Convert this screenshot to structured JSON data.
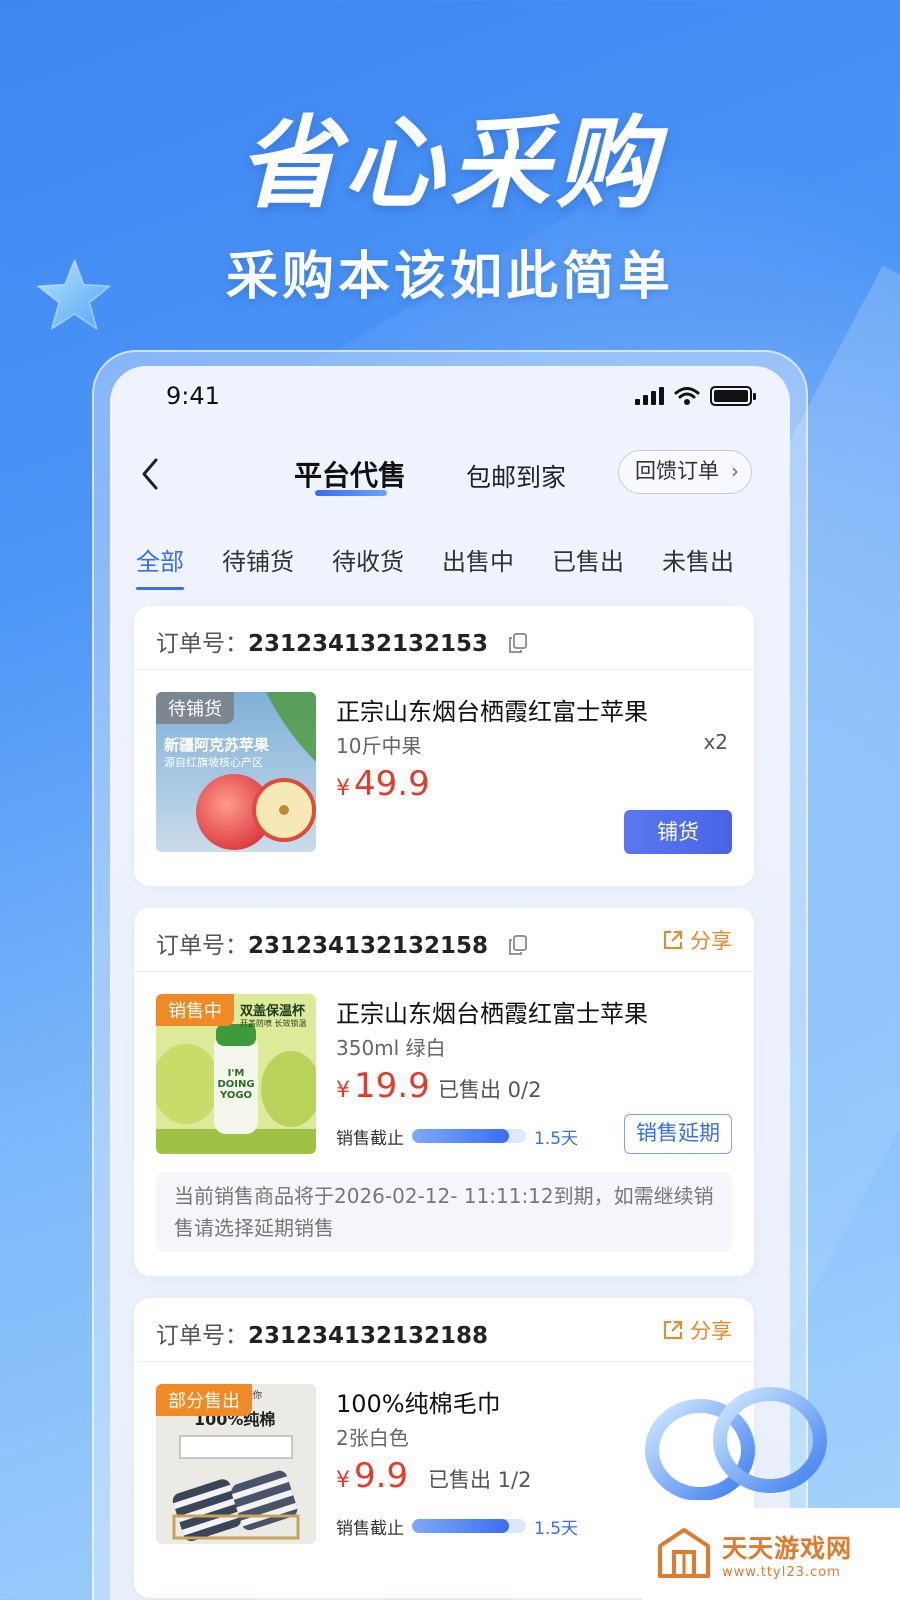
{
  "promo": {
    "headline": "省心采购",
    "subline": "采购本该如此简单"
  },
  "status_bar": {
    "time": "9:41"
  },
  "nav": {
    "active_tab": "平台代售",
    "tab_2": "包邮到家",
    "feedback_button": "回馈订单"
  },
  "filters": [
    "全部",
    "待铺货",
    "待收货",
    "出售中",
    "已售出",
    "未售出"
  ],
  "orders": [
    {
      "order_label": "订单号：",
      "order_no": "231234132132153",
      "tag": "待铺货",
      "image_text_1": "新疆阿克苏苹果",
      "image_text_2": "源自红旗坡核心产区",
      "title": "正宗山东烟台栖霞红富士苹果",
      "spec": "10斤中果",
      "qty": "x2",
      "price_symbol": "¥",
      "price": "49.9",
      "action": "铺货"
    },
    {
      "order_label": "订单号：",
      "order_no": "231234132132158",
      "share": "分享",
      "tag": "销售中",
      "image_text_1": "双盖保温杯",
      "image_text_2": "开盖防喷 长效锁温",
      "bottle_text": "I'M DOING YOGO",
      "title": "正宗山东烟台栖霞红富士苹果",
      "spec": "350ml 绿白",
      "price_symbol": "¥",
      "price": "19.9",
      "sold": "已售出 0/2",
      "deadline_label": "销售截止",
      "deadline_days": "1.5天",
      "deadline_progress": 0.85,
      "action": "销售延期",
      "notice": "当前销售商品将于2026-02-12- 11:11:12到期，如需继续销售请选择延期销售"
    },
    {
      "order_label": "订单号：",
      "order_no": "231234132132188",
      "share": "分享",
      "tag": "部分售出",
      "image_text_1": "我们懂你",
      "image_text_2": "100%纯棉",
      "title": "100%纯棉毛巾",
      "spec": "2张白色",
      "price_symbol": "¥",
      "price": "9.9",
      "sold": "已售出 1/2",
      "deadline_label": "销售截止",
      "deadline_days": "1.5天",
      "deadline_progress": 0.85
    }
  ],
  "watermark": {
    "name": "天天游戏网",
    "url": "www.ttyl23.com"
  },
  "colors": {
    "accent": "#3a6ef2",
    "price": "#e53a2e",
    "tag_orange": "#f08a24",
    "share": "#e8882a"
  }
}
